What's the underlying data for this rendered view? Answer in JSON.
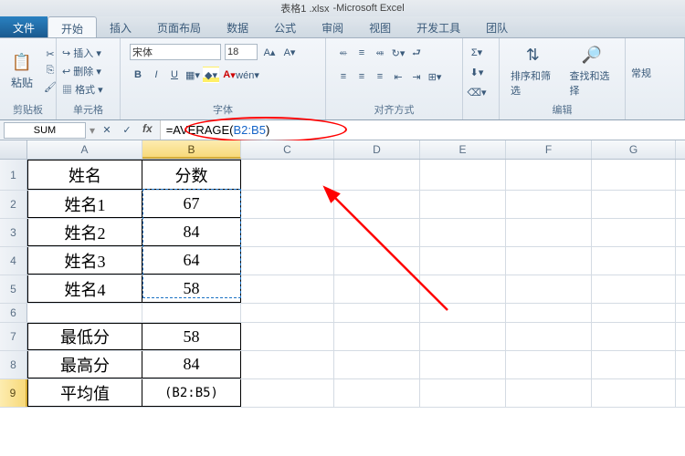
{
  "title": {
    "doc": "表格1 .xlsx",
    "app": "Microsoft Excel"
  },
  "tabs": {
    "file": "文件",
    "items": [
      "开始",
      "插入",
      "页面布局",
      "数据",
      "公式",
      "审阅",
      "视图",
      "开发工具",
      "团队"
    ],
    "activeIndex": 0
  },
  "ribbon": {
    "clipboard": {
      "paste": "粘贴",
      "insert": "插入",
      "delete": "删除",
      "format": "格式",
      "group_label": "剪贴板"
    },
    "cells": {
      "group_label": "单元格"
    },
    "font": {
      "name": "宋体",
      "size": "18",
      "group_label": "字体"
    },
    "alignment": {
      "group_label": "对齐方式"
    },
    "editing": {
      "sort": "排序和筛选",
      "find": "查找和选择",
      "group_label": "编辑"
    },
    "styles": {
      "label": "常规"
    }
  },
  "namebox": "SUM",
  "formula": {
    "prefix": "=AVERAGE(",
    "ref": "B2:B5",
    "suffix": ")"
  },
  "columns": [
    "A",
    "B",
    "C",
    "D",
    "E",
    "F",
    "G"
  ],
  "rows": [
    "1",
    "2",
    "3",
    "4",
    "5",
    "6",
    "7",
    "8",
    "9"
  ],
  "table_data": {
    "A1": "姓名",
    "B1": "分数",
    "A2": "姓名1",
    "B2": "67",
    "A3": "姓名2",
    "B3": "84",
    "A4": "姓名3",
    "B4": "64",
    "A5": "姓名4",
    "B5": "58",
    "A7": "最低分",
    "B7": "58",
    "A8": "最高分",
    "B8": "84",
    "A9": "平均值",
    "B9": "(B2:B5)"
  }
}
